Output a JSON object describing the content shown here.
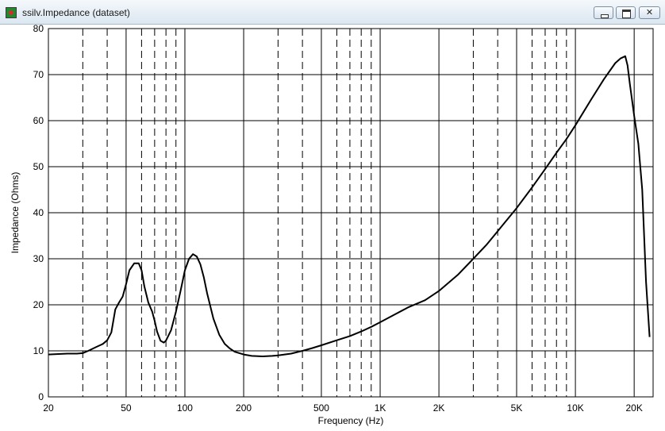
{
  "window": {
    "title": "ssilv.Impedance (dataset)",
    "close_glyph": "✕",
    "icons": {
      "app": "app-icon",
      "minimize": "minimize-icon",
      "maximize": "maximize-icon",
      "close": "close-icon"
    }
  },
  "chart_data": {
    "type": "line",
    "xlabel": "Frequency (Hz)",
    "ylabel": "Impedance (Ohms)",
    "x_scale": "log",
    "xlim": [
      20,
      25000
    ],
    "ylim": [
      0,
      80
    ],
    "grid": true,
    "x_major_ticks": [
      20,
      50,
      100,
      200,
      500,
      1000,
      2000,
      5000,
      10000,
      20000
    ],
    "x_tick_labels": [
      "20",
      "50",
      "100",
      "200",
      "500",
      "1K",
      "2K",
      "5K",
      "10K",
      "20K"
    ],
    "x_minor_ticks": [
      30,
      40,
      60,
      70,
      80,
      90,
      300,
      400,
      600,
      700,
      800,
      900,
      3000,
      4000,
      6000,
      7000,
      8000,
      9000
    ],
    "y_ticks": [
      0,
      10,
      20,
      30,
      40,
      50,
      60,
      70,
      80
    ],
    "y_tick_labels": [
      "0",
      "10",
      "20",
      "30",
      "40",
      "50",
      "60",
      "70",
      "80"
    ],
    "line_color": "#000000",
    "series": [
      {
        "x": [
          20,
          22,
          25,
          28,
          30,
          32,
          35,
          38,
          40,
          42,
          44,
          46,
          48,
          50,
          52,
          55,
          58,
          60,
          62,
          65,
          68,
          70,
          72,
          75,
          78,
          80,
          85,
          90,
          95,
          100,
          105,
          110,
          115,
          120,
          125,
          130,
          140,
          150,
          160,
          170,
          180,
          200,
          220,
          250,
          280,
          300,
          350,
          400,
          450,
          500,
          600,
          700,
          800,
          900,
          1000,
          1200,
          1400,
          1700,
          2000,
          2500,
          3000,
          3500,
          4000,
          5000,
          6000,
          7000,
          8000,
          9000,
          10000,
          12000,
          14000,
          16000,
          17000,
          18000,
          18500,
          19000,
          20000,
          21000,
          22000,
          23000,
          24000
        ],
        "y": [
          9.2,
          9.3,
          9.4,
          9.4,
          9.5,
          10.0,
          10.8,
          11.5,
          12.3,
          14.0,
          19.0,
          20.5,
          21.8,
          24.5,
          27.5,
          29.0,
          29.0,
          27.5,
          24.0,
          20.5,
          18.5,
          16.5,
          14.2,
          12.2,
          11.8,
          12.2,
          14.5,
          18.5,
          23.0,
          27.5,
          30.0,
          31.0,
          30.5,
          28.8,
          26.0,
          22.5,
          17.0,
          13.5,
          11.5,
          10.5,
          9.8,
          9.2,
          8.9,
          8.8,
          8.9,
          9.0,
          9.4,
          10.0,
          10.6,
          11.2,
          12.3,
          13.2,
          14.2,
          15.2,
          16.2,
          18.0,
          19.5,
          21.0,
          23.0,
          26.5,
          30.0,
          33.0,
          36.0,
          41.0,
          45.5,
          49.5,
          53.0,
          56.0,
          59.0,
          64.5,
          69.0,
          72.5,
          73.5,
          74.0,
          72.0,
          68.0,
          61.0,
          55.0,
          45.0,
          25.0,
          13.0
        ]
      }
    ]
  }
}
